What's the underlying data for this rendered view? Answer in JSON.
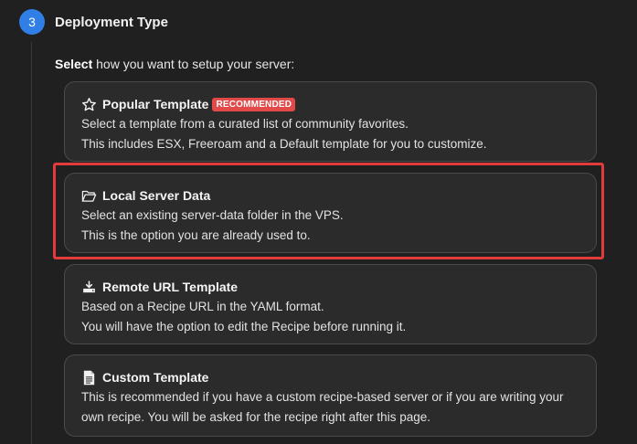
{
  "step": {
    "number": "3",
    "title": "Deployment Type",
    "accent_color": "#2f7fe6"
  },
  "prompt": {
    "bold": "Select",
    "rest": " how you want to setup your server:"
  },
  "options": [
    {
      "title": "Popular Template",
      "icon": "star-icon",
      "badge": "RECOMMENDED",
      "lines": [
        "Select a template from a curated list of community favorites.",
        "This includes ESX, Freeroam and a Default template for you to customize."
      ]
    },
    {
      "title": "Local Server Data",
      "icon": "folder-open-icon",
      "lines": [
        "Select an existing server-data folder in the VPS.",
        "This is the option you are already used to."
      ]
    },
    {
      "title": "Remote URL Template",
      "icon": "download-tray-icon",
      "lines": [
        "Based on a Recipe URL in the YAML format.",
        "You will have the option to edit the Recipe before running it."
      ]
    },
    {
      "title": "Custom Template",
      "icon": "file-text-icon",
      "lines": [
        "This is recommended if you have a custom recipe-based server or if you are writing your",
        "own recipe. You will be asked for the recipe right after this page."
      ]
    }
  ],
  "colors": {
    "badge": "#e24a4a",
    "highlight": "#e23b3b"
  }
}
